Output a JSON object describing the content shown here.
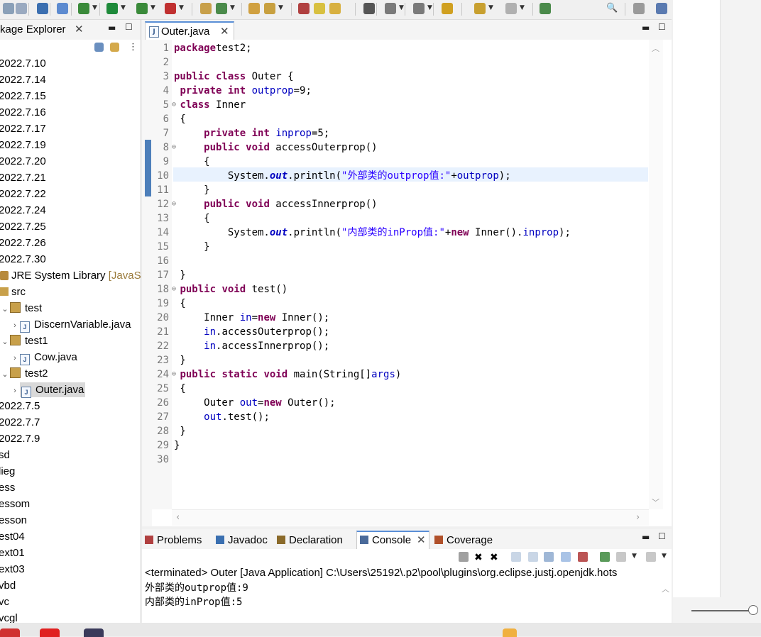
{
  "toolbar": {
    "icons": [
      "save-icon",
      "save-all-icon",
      "console-icon",
      "pointer-icon",
      "debug-icon",
      "run-icon",
      "run-config-icon",
      "coverage-icon",
      "new-package-icon",
      "new-class-icon",
      "open-type-icon",
      "open-task-icon",
      "toggle-breadcrumb-icon",
      "mark-occurrences-icon",
      "word-wrap-icon",
      "show-whitespace-icon",
      "next-annotation-icon",
      "previous-annotation-icon",
      "last-edit-icon",
      "back-icon",
      "forward-icon",
      "pin-editor-icon",
      "search-icon",
      "perspective-icon",
      "java-perspective-icon"
    ]
  },
  "package_explorer": {
    "title": "kage Explorer",
    "items": [
      {
        "label": "2022.7.10",
        "type": "project"
      },
      {
        "label": "2022.7.14",
        "type": "project"
      },
      {
        "label": "2022.7.15",
        "type": "project"
      },
      {
        "label": "2022.7.16",
        "type": "project"
      },
      {
        "label": "2022.7.17",
        "type": "project"
      },
      {
        "label": "2022.7.19",
        "type": "project"
      },
      {
        "label": "2022.7.20",
        "type": "project"
      },
      {
        "label": "2022.7.21",
        "type": "project"
      },
      {
        "label": "2022.7.22",
        "type": "project"
      },
      {
        "label": "2022.7.24",
        "type": "project"
      },
      {
        "label": "2022.7.25",
        "type": "project"
      },
      {
        "label": "2022.7.26",
        "type": "project"
      },
      {
        "label": "2022.7.30",
        "type": "project"
      },
      {
        "label": "JRE System Library",
        "suffix": "[JavaS",
        "type": "jre"
      },
      {
        "label": "src",
        "type": "src"
      },
      {
        "label": "test",
        "type": "package"
      },
      {
        "label": "DiscernVariable.java",
        "type": "file"
      },
      {
        "label": "test1",
        "type": "package"
      },
      {
        "label": "Cow.java",
        "type": "file"
      },
      {
        "label": "test2",
        "type": "package"
      },
      {
        "label": "Outer.java",
        "type": "file-selected"
      },
      {
        "label": "2022.7.5",
        "type": "project"
      },
      {
        "label": "2022.7.7",
        "type": "project"
      },
      {
        "label": "2022.7.9",
        "type": "project"
      },
      {
        "label": "sd",
        "type": "project"
      },
      {
        "label": "lieg",
        "type": "project"
      },
      {
        "label": "ess",
        "type": "project"
      },
      {
        "label": "essom",
        "type": "project"
      },
      {
        "label": "esson",
        "type": "project"
      },
      {
        "label": "est04",
        "type": "project"
      },
      {
        "label": "ext01",
        "type": "project"
      },
      {
        "label": "ext03",
        "type": "project"
      },
      {
        "label": "vbd",
        "type": "project"
      },
      {
        "label": "vc",
        "type": "project"
      },
      {
        "label": "vcgl",
        "type": "project"
      }
    ]
  },
  "editor": {
    "tab_label": "Outer.java",
    "highlighted_line": 10,
    "lines": [
      {
        "n": "1",
        "segs": [
          [
            "kw",
            "package"
          ],
          [
            "",
            "test2;"
          ]
        ]
      },
      {
        "n": "2",
        "segs": []
      },
      {
        "n": "3",
        "segs": [
          [
            "kw",
            "public class"
          ],
          [
            "",
            " Outer {"
          ]
        ]
      },
      {
        "n": "4",
        "segs": [
          [
            "",
            " "
          ],
          [
            "kw",
            "private int"
          ],
          [
            "",
            " "
          ],
          [
            "fld",
            "outprop"
          ],
          [
            "",
            "=9;"
          ]
        ]
      },
      {
        "n": "5",
        "fold": true,
        "segs": [
          [
            "",
            " "
          ],
          [
            "kw",
            "class"
          ],
          [
            "",
            " Inner"
          ]
        ]
      },
      {
        "n": "6",
        "segs": [
          [
            "",
            " {"
          ]
        ]
      },
      {
        "n": "7",
        "segs": [
          [
            "",
            "     "
          ],
          [
            "kw",
            "private int"
          ],
          [
            "",
            " "
          ],
          [
            "fld",
            "inprop"
          ],
          [
            "",
            "=5;"
          ]
        ]
      },
      {
        "n": "8",
        "fold": true,
        "segs": [
          [
            "",
            "     "
          ],
          [
            "kw",
            "public void"
          ],
          [
            "",
            " accessOuterprop()"
          ]
        ]
      },
      {
        "n": "9",
        "segs": [
          [
            "",
            "     {"
          ]
        ]
      },
      {
        "n": "10",
        "segs": [
          [
            "",
            "         System."
          ],
          [
            "so",
            "out"
          ],
          [
            "",
            ".println("
          ],
          [
            "st",
            "\"外部类的outprop值:\""
          ],
          [
            "",
            "+"
          ],
          [
            "fld",
            "outprop"
          ],
          [
            "",
            ");"
          ]
        ]
      },
      {
        "n": "11",
        "segs": [
          [
            "",
            "     }"
          ]
        ]
      },
      {
        "n": "12",
        "fold": true,
        "segs": [
          [
            "",
            "     "
          ],
          [
            "kw",
            "public void"
          ],
          [
            "",
            " accessInnerprop()"
          ]
        ]
      },
      {
        "n": "13",
        "segs": [
          [
            "",
            "     {"
          ]
        ]
      },
      {
        "n": "14",
        "segs": [
          [
            "",
            "         System."
          ],
          [
            "so",
            "out"
          ],
          [
            "",
            ".println("
          ],
          [
            "st",
            "\"内部类的inProp值:\""
          ],
          [
            "",
            "+"
          ],
          [
            "kw",
            "new"
          ],
          [
            "",
            " Inner()."
          ],
          [
            "fld",
            "inprop"
          ],
          [
            "",
            ");"
          ]
        ]
      },
      {
        "n": "15",
        "segs": [
          [
            "",
            "     }"
          ]
        ]
      },
      {
        "n": "16",
        "segs": []
      },
      {
        "n": "17",
        "segs": [
          [
            "",
            " }"
          ]
        ]
      },
      {
        "n": "18",
        "fold": true,
        "segs": [
          [
            "",
            " "
          ],
          [
            "kw",
            "public void"
          ],
          [
            "",
            " test()"
          ]
        ]
      },
      {
        "n": "19",
        "segs": [
          [
            "",
            " {"
          ]
        ]
      },
      {
        "n": "20",
        "segs": [
          [
            "",
            "     Inner "
          ],
          [
            "fld",
            "in"
          ],
          [
            "",
            "="
          ],
          [
            "kw",
            "new"
          ],
          [
            "",
            " Inner();"
          ]
        ]
      },
      {
        "n": "21",
        "segs": [
          [
            "",
            "     "
          ],
          [
            "fld",
            "in"
          ],
          [
            "",
            ".accessOuterprop();"
          ]
        ]
      },
      {
        "n": "22",
        "segs": [
          [
            "",
            "     "
          ],
          [
            "fld",
            "in"
          ],
          [
            "",
            ".accessInnerprop();"
          ]
        ]
      },
      {
        "n": "23",
        "segs": [
          [
            "",
            " }"
          ]
        ]
      },
      {
        "n": "24",
        "fold": true,
        "segs": [
          [
            "",
            " "
          ],
          [
            "kw",
            "public static void"
          ],
          [
            "",
            " main(String[]"
          ],
          [
            "fld",
            "args"
          ],
          [
            "",
            ")"
          ]
        ]
      },
      {
        "n": "25",
        "segs": [
          [
            "",
            " {"
          ]
        ]
      },
      {
        "n": "26",
        "segs": [
          [
            "",
            "     Outer "
          ],
          [
            "fld",
            "out"
          ],
          [
            "",
            "="
          ],
          [
            "kw",
            "new"
          ],
          [
            "",
            " Outer();"
          ]
        ]
      },
      {
        "n": "27",
        "segs": [
          [
            "",
            "     "
          ],
          [
            "fld",
            "out"
          ],
          [
            "",
            ".test();"
          ]
        ]
      },
      {
        "n": "28",
        "segs": [
          [
            "",
            " }"
          ]
        ]
      },
      {
        "n": "29",
        "segs": [
          [
            "",
            "}"
          ]
        ]
      },
      {
        "n": "30",
        "segs": []
      }
    ]
  },
  "bottom_panel": {
    "tabs": [
      {
        "label": "Problems",
        "icon": "problems-icon",
        "active": false
      },
      {
        "label": "Javadoc",
        "icon": "javadoc-icon",
        "active": false
      },
      {
        "label": "Declaration",
        "icon": "declaration-icon",
        "active": false
      },
      {
        "label": "Console",
        "icon": "console-icon",
        "active": true
      },
      {
        "label": "Coverage",
        "icon": "coverage-icon",
        "active": false
      }
    ],
    "console_header": "<terminated> Outer [Java Application] C:\\Users\\25192\\.p2\\pool\\plugins\\org.eclipse.justj.openjdk.hots",
    "output": [
      "外部类的outprop值:9",
      "内部类的inProp值:5"
    ]
  },
  "colors": {
    "keyword": "#7f0055",
    "field": "#0000c0",
    "string": "#2a00ff",
    "highlight": "#e8f2fe",
    "accent": "#5a8fd6"
  }
}
